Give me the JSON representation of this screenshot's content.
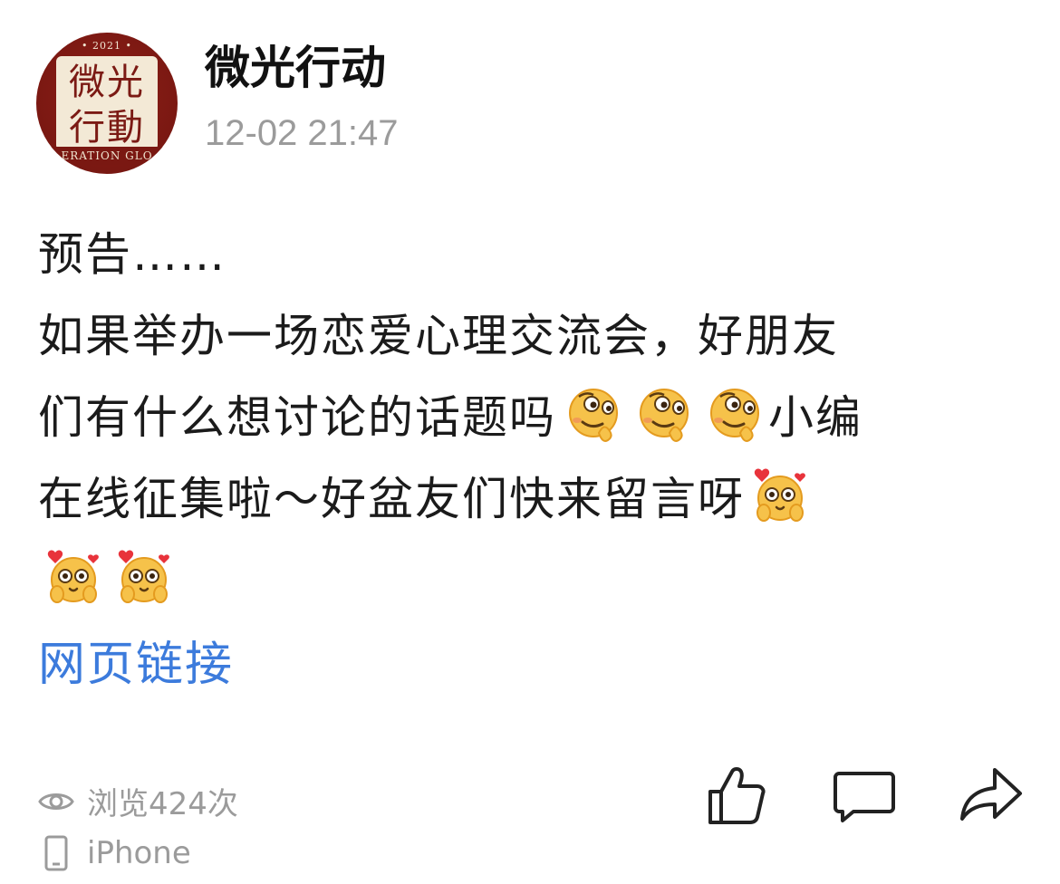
{
  "post": {
    "author": "微光行动",
    "timestamp": "12-02 21:47",
    "avatar_year": "• 2021 •",
    "avatar_seal_top": "微光",
    "avatar_seal_bottom": "行動",
    "avatar_ribbon": "ERATION GLO",
    "lines": [
      "预告……",
      "如果举办一场恋爱心理交流会，好朋友",
      "们有什么想讨论的话题吗",
      "小编",
      "在线征集啦～好盆友们快来留言呀"
    ],
    "link_text": "网页链接",
    "views": "浏览424次",
    "device": "iPhone"
  },
  "icons": {
    "view": "eye-icon",
    "device": "phone-icon",
    "like": "thumbs-up-icon",
    "comment": "comment-icon",
    "share": "share-icon",
    "emoji_thinking": "thinking-face-emoji",
    "emoji_love": "love-eyes-emoji"
  },
  "colors": {
    "text": "#1b1b1b",
    "muted": "#9b9b9b",
    "link": "#3c7bdc",
    "avatar_red": "#7a1812",
    "avatar_cream": "#f3e9d6"
  }
}
